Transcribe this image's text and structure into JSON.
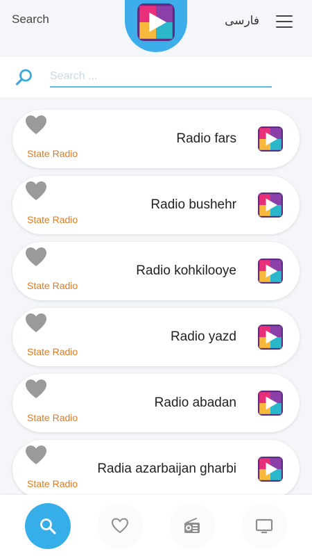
{
  "header": {
    "search_label": "Search",
    "language_label": "فارسی"
  },
  "search": {
    "placeholder": "Search ...",
    "value": ""
  },
  "stations": [
    {
      "name": "Radio fars",
      "category": "State Radio"
    },
    {
      "name": "Radio bushehr",
      "category": "State Radio"
    },
    {
      "name": "Radio kohkilooye",
      "category": "State Radio"
    },
    {
      "name": "Radio yazd",
      "category": "State Radio"
    },
    {
      "name": "Radio abadan",
      "category": "State Radio"
    },
    {
      "name": "Radia azarbaijan gharbi",
      "category": "State Radio"
    }
  ],
  "bottom_nav": [
    {
      "icon": "search-icon",
      "active": true
    },
    {
      "icon": "heart-icon",
      "active": false
    },
    {
      "icon": "radio-icon",
      "active": false
    },
    {
      "icon": "tv-icon",
      "active": false
    }
  ],
  "colors": {
    "accent": "#35aee9",
    "category": "#e07a1a",
    "heart": "#9a9a9a"
  }
}
